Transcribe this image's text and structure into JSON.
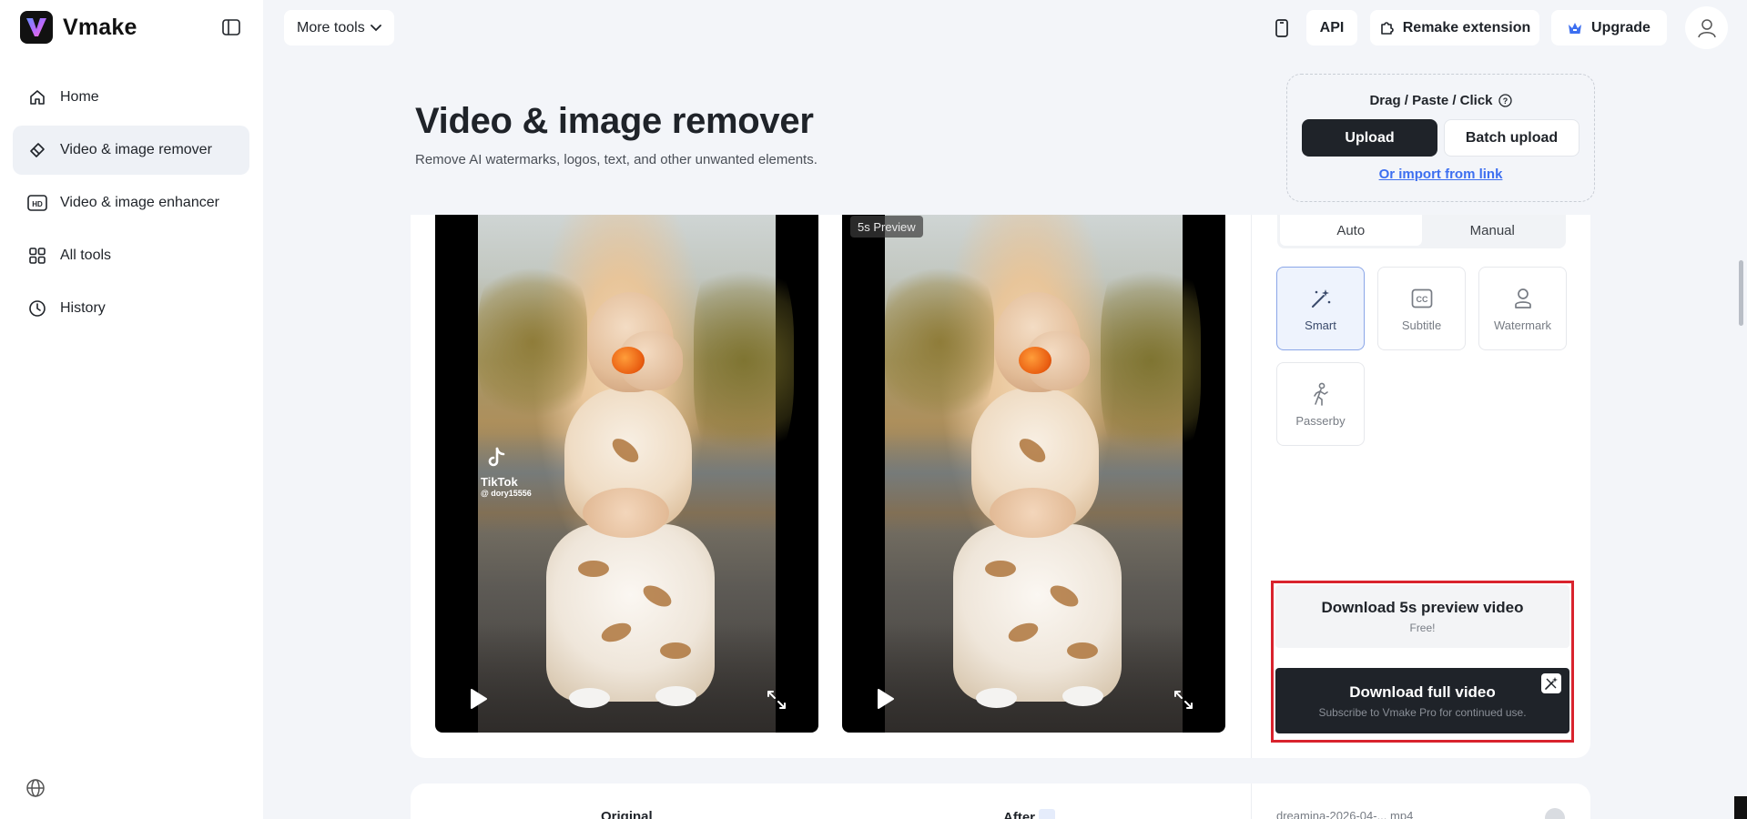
{
  "app": {
    "name": "Vmake"
  },
  "sidebar": {
    "items": [
      {
        "label": "Home",
        "icon": "home-icon"
      },
      {
        "label": "Video & image remover",
        "icon": "eraser-icon",
        "active": true
      },
      {
        "label": "Video & image enhancer",
        "icon": "hd-icon"
      },
      {
        "label": "All tools",
        "icon": "grid-icon"
      },
      {
        "label": "History",
        "icon": "clock-icon"
      }
    ]
  },
  "topbar": {
    "more_tools": "More tools",
    "api": "API",
    "remake_extension": "Remake extension",
    "upgrade": "Upgrade"
  },
  "header": {
    "title": "Video & image remover",
    "subtitle": "Remove AI watermarks, logos, text, and other unwanted elements."
  },
  "upload": {
    "hint": "Drag / Paste / Click",
    "upload_label": "Upload",
    "batch_label": "Batch upload",
    "import_link": "Or import from link"
  },
  "preview": {
    "original_watermark_brand": "TikTok",
    "original_watermark_user": "@ dory15556",
    "after_badge": "5s Preview"
  },
  "panel": {
    "mode_tabs": [
      {
        "label": "Auto",
        "active": true
      },
      {
        "label": "Manual",
        "active": false
      }
    ],
    "tools": [
      {
        "label": "Smart",
        "icon": "magic-wand-icon",
        "active": true
      },
      {
        "label": "Subtitle",
        "icon": "cc-icon",
        "active": false
      },
      {
        "label": "Watermark",
        "icon": "person-icon",
        "active": false
      },
      {
        "label": "Passerby",
        "icon": "walker-icon",
        "active": false
      }
    ],
    "download_preview": {
      "title": "Download 5s preview video",
      "sub": "Free!"
    },
    "download_full": {
      "title": "Download full video",
      "sub": "Subscribe to Vmake Pro for continued use."
    }
  },
  "second_card": {
    "original_label": "Original",
    "after_label": "After",
    "file_name": "dreamina-2026-04-... mp4"
  },
  "colors": {
    "accent_dark": "#1f2329",
    "link_blue": "#3d6ff0",
    "highlight_red": "#d9232d",
    "active_bg": "#eef3fd"
  }
}
